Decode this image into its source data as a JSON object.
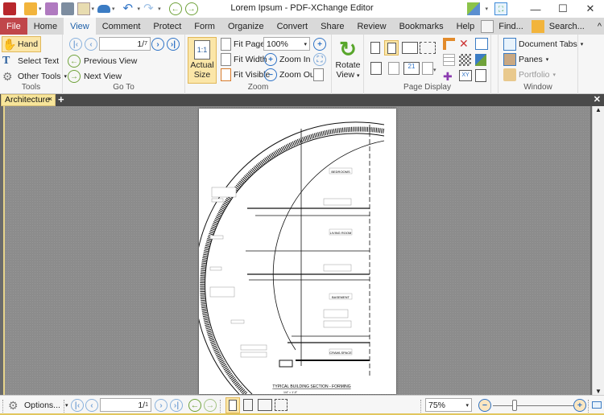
{
  "window": {
    "title": "Lorem Ipsum - PDF-XChange Editor",
    "controls": {
      "minimize": "—",
      "maximize": "☐",
      "close": "✕"
    }
  },
  "qat": {
    "icons": [
      "app-logo-icon",
      "open-folder-icon",
      "save-icon",
      "print-icon",
      "email-icon",
      "scan-icon",
      "undo-icon",
      "redo-icon",
      "back-icon",
      "forward-icon"
    ]
  },
  "ribbon_tabs": [
    {
      "label": "File"
    },
    {
      "label": "Home"
    },
    {
      "label": "View"
    },
    {
      "label": "Comment"
    },
    {
      "label": "Protect"
    },
    {
      "label": "Form"
    },
    {
      "label": "Organize"
    },
    {
      "label": "Convert"
    },
    {
      "label": "Share"
    },
    {
      "label": "Review"
    },
    {
      "label": "Bookmarks"
    },
    {
      "label": "Help"
    }
  ],
  "active_tab": "View",
  "right_tools": {
    "find": "Find...",
    "search": "Search...",
    "collapse": "^"
  },
  "groups": {
    "tools": {
      "label": "Tools",
      "hand": "Hand",
      "select_text": "Select Text",
      "other_tools": "Other Tools"
    },
    "goto": {
      "label": "Go To",
      "page_value": "1",
      "page_total": "7",
      "previous_view": "Previous View",
      "next_view": "Next View"
    },
    "zoom": {
      "label": "Zoom",
      "actual_size_line1": "Actual",
      "actual_size_line2": "Size",
      "fit_page": "Fit Page",
      "fit_width": "Fit Width",
      "fit_visible": "Fit Visible",
      "zoom_value": "100%",
      "zoom_in": "Zoom In",
      "zoom_out": "Zoom Out",
      "rotate_line1": "Rotate",
      "rotate_line2": "View"
    },
    "page_display": {
      "label": "Page Display"
    },
    "window": {
      "label": "Window",
      "document_tabs": "Document Tabs",
      "panes": "Panes",
      "portfolio": "Portfolio"
    }
  },
  "document_tabs": [
    {
      "label": "Architecture",
      "close": "×"
    }
  ],
  "new_tab": "+",
  "close_all": "✕",
  "drawing": {
    "labels": [
      "BEDROOMS",
      "LIVING ROOM",
      "BASEMENT",
      "CRAWLSPACE"
    ],
    "title": "TYPICAL BUILDING SECTION - FORMING",
    "scale": "1/4\" = 1'-0\""
  },
  "statusbar": {
    "options": "Options...",
    "page_value": "1",
    "page_total": "1",
    "zoom_value": "75%",
    "zoom_slider_percent": 75
  },
  "colors": {
    "file_tab": "#c0464a",
    "active_tab_text": "#1d5fa8",
    "highlight": "#fbe6a8",
    "doc_tab": "#f7e59a"
  }
}
